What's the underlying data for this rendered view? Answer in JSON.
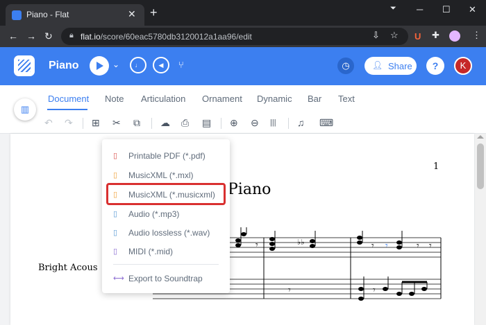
{
  "browser": {
    "tab_title": "Piano - Flat",
    "close_tab": "✕",
    "new_tab": "+",
    "controls": {
      "minimize": "─",
      "maximize": "☐",
      "close": "✕"
    },
    "url_domain": "flat.io",
    "url_path": "/score/60eac5780db3120012a1aa96/edit",
    "extension_u": "U"
  },
  "app": {
    "score_title": "Piano",
    "share_label": "Share",
    "user_initial": "K",
    "help_glyph": "?",
    "accent_color": "#3c7ff0"
  },
  "ribbon": {
    "tabs": [
      {
        "label": "Document",
        "active": true
      },
      {
        "label": "Note"
      },
      {
        "label": "Articulation"
      },
      {
        "label": "Ornament"
      },
      {
        "label": "Dynamic"
      },
      {
        "label": "Bar"
      },
      {
        "label": "Text"
      }
    ],
    "tools": [
      {
        "icon": "undo-icon",
        "glyph": "↶",
        "disabled": true
      },
      {
        "icon": "redo-icon",
        "glyph": "↷",
        "disabled": true
      },
      {
        "icon": "add-page-icon",
        "glyph": "⊞"
      },
      {
        "icon": "scissors-icon",
        "glyph": "✂"
      },
      {
        "icon": "copy-icon",
        "glyph": "⧉"
      },
      {
        "icon": "cloud-export-icon",
        "glyph": "☁"
      },
      {
        "icon": "print-icon",
        "glyph": "⎙"
      },
      {
        "icon": "layout-icon",
        "glyph": "▤"
      },
      {
        "icon": "zoom-in-icon",
        "glyph": "⊕"
      },
      {
        "icon": "zoom-out-icon",
        "glyph": "⊖"
      },
      {
        "icon": "barlines-icon",
        "glyph": "|||"
      },
      {
        "icon": "instrument-icon",
        "glyph": "♫"
      },
      {
        "icon": "keyboard-icon",
        "glyph": "⌨"
      }
    ]
  },
  "score": {
    "page_number": "1",
    "title_visible": "Piano",
    "instrument_visible": "Bright Acous"
  },
  "export_menu": {
    "items": [
      {
        "label": "Printable PDF (*.pdf)",
        "icon": "pdf-icon",
        "glyph": "▯",
        "color": "#d9534f"
      },
      {
        "label": "MusicXML (*.mxl)",
        "icon": "mxl-file-icon",
        "glyph": "▯",
        "color": "#f0a23c"
      },
      {
        "label": "MusicXML (*.musicxml)",
        "icon": "musicxml-file-icon",
        "glyph": "▯",
        "color": "#f0a23c",
        "highlighted": true
      },
      {
        "label": "Audio (*.mp3)",
        "icon": "audio-file-icon",
        "glyph": "▯",
        "color": "#5b9bd5"
      },
      {
        "label": "Audio lossless (*.wav)",
        "icon": "audio-lossless-icon",
        "glyph": "▯",
        "color": "#5b9bd5"
      },
      {
        "label": "MIDI (*.mid)",
        "icon": "midi-file-icon",
        "glyph": "▯",
        "color": "#8a6bd1"
      },
      {
        "label": "Export to Soundtrap",
        "icon": "soundtrap-icon",
        "glyph": "⟷",
        "color": "#8a6bd1"
      }
    ],
    "highlight_color": "#d93030"
  }
}
